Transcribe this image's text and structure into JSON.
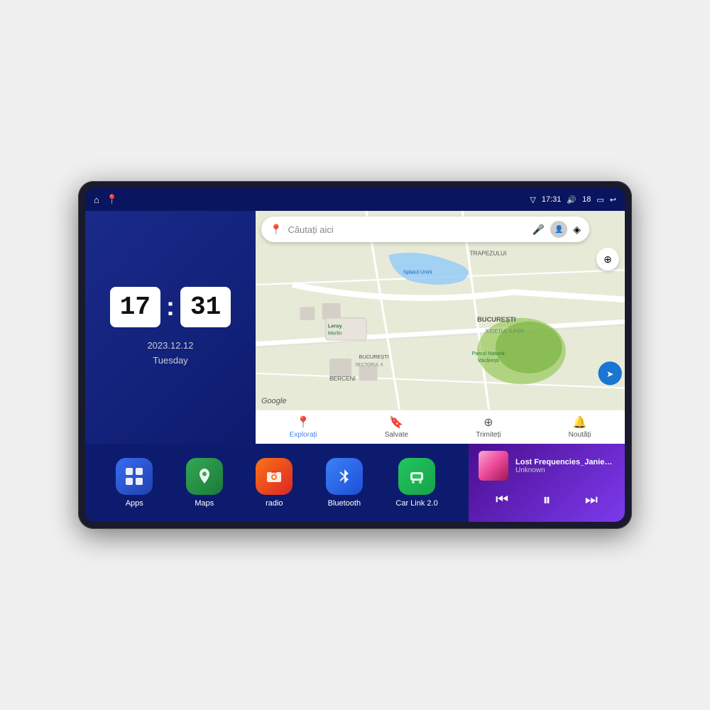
{
  "device": {
    "status_bar": {
      "left_icons": [
        "home",
        "maps"
      ],
      "time": "17:31",
      "volume": "18",
      "battery": "▭",
      "back": "↩"
    },
    "clock": {
      "hours": "17",
      "minutes": "31",
      "date": "2023.12.12",
      "day": "Tuesday"
    },
    "map": {
      "search_placeholder": "Căutați aici",
      "nav_items": [
        {
          "label": "Explorați",
          "icon": "📍",
          "active": true
        },
        {
          "label": "Salvate",
          "icon": "🔖",
          "active": false
        },
        {
          "label": "Trimiteți",
          "icon": "⊕",
          "active": false
        },
        {
          "label": "Noutăți",
          "icon": "🔔",
          "active": false
        }
      ],
      "poi_labels": [
        "BUCURESTI SECTORUL 4",
        "Parcul Natural Văcărești",
        "BERCENI",
        "SPLAIUL UNIRII",
        "TRAPEZULUI",
        "JUDETUL ILFOV",
        "BUCURESTI"
      ]
    },
    "apps": [
      {
        "id": "apps",
        "label": "Apps",
        "icon": "⊞",
        "class": "apps-icon"
      },
      {
        "id": "maps",
        "label": "Maps",
        "icon": "🗺",
        "class": "maps-icon"
      },
      {
        "id": "radio",
        "label": "radio",
        "icon": "📻",
        "class": "radio-icon"
      },
      {
        "id": "bluetooth",
        "label": "Bluetooth",
        "icon": "⚡",
        "class": "bluetooth-icon"
      },
      {
        "id": "carlink",
        "label": "Car Link 2.0",
        "icon": "📱",
        "class": "carlink-icon"
      }
    ],
    "music": {
      "title": "Lost Frequencies_Janieck Devy-...",
      "artist": "Unknown",
      "controls": {
        "prev": "⏮",
        "play": "⏸",
        "next": "⏭"
      }
    }
  }
}
